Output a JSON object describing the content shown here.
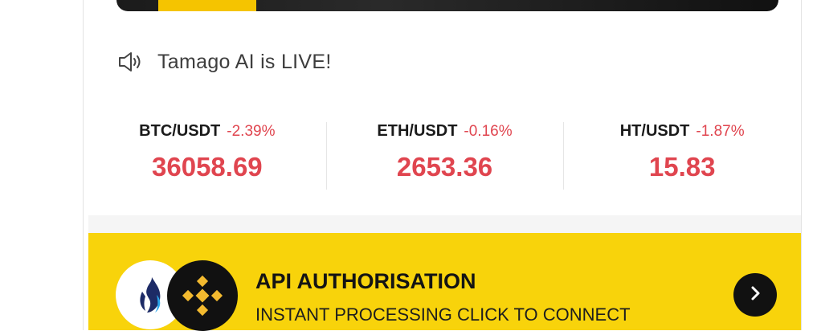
{
  "announcement": {
    "icon": "speaker-icon",
    "text": "Tamago AI is LIVE!"
  },
  "tickers": [
    {
      "pair": "BTC/USDT",
      "change": "-2.39%",
      "price": "36058.69"
    },
    {
      "pair": "ETH/USDT",
      "change": "-0.16%",
      "price": "2653.36"
    },
    {
      "pair": "HT/USDT",
      "change": "-1.87%",
      "price": "15.83"
    }
  ],
  "api_card": {
    "title": "API AUTHORISATION",
    "subtitle": "INSTANT PROCESSING CLICK TO CONNECT",
    "logos": [
      "huobi-logo",
      "binance-logo"
    ],
    "action_icon": "chevron-right-icon"
  },
  "colors": {
    "negative": "#e0454f",
    "accent_yellow": "#f8d30b",
    "dark": "#111111"
  }
}
